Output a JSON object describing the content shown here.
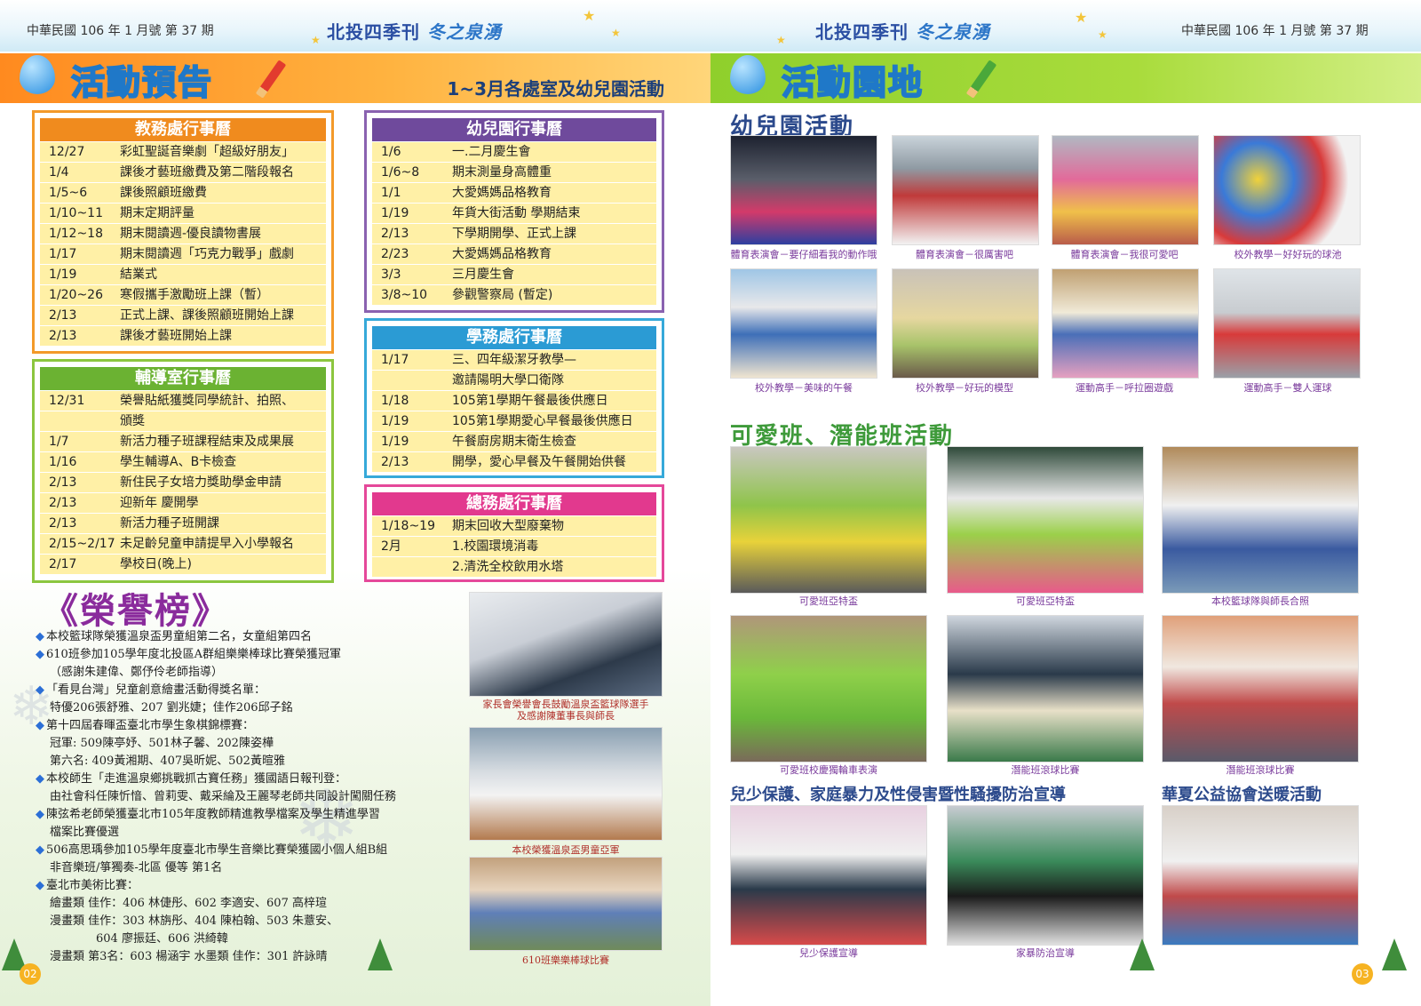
{
  "left": {
    "issue": "中華民國 106 年 1 月號 第 37 期",
    "mag_title": "北投四季刊",
    "mag_sub": "冬之泉湧",
    "banner_title": "活動預告",
    "banner_sub": "1~3月各處室及幼兒園活動",
    "page_num": "02",
    "calendars": [
      {
        "title": "教務處行事曆",
        "rows": [
          {
            "d": "12/27",
            "t": "彩虹聖誕音樂劇「超級好朋友」"
          },
          {
            "d": "1/4",
            "t": "課後才藝班繳費及第二階段報名"
          },
          {
            "d": "1/5~6",
            "t": "課後照顧班繳費"
          },
          {
            "d": "1/10~11",
            "t": "期末定期評量"
          },
          {
            "d": "1/12~18",
            "t": "期末閱讀週-優良讀物書展"
          },
          {
            "d": "1/17",
            "t": "期末閱讀週「巧克力戰爭」戲劇"
          },
          {
            "d": "1/19",
            "t": "結業式"
          },
          {
            "d": "1/20~26",
            "t": "寒假攜手激勵班上課（暫）"
          },
          {
            "d": "2/13",
            "t": "正式上課、課後照顧班開始上課"
          },
          {
            "d": "2/13",
            "t": "課後才藝班開始上課"
          }
        ]
      },
      {
        "title": "輔導室行事曆",
        "rows": [
          {
            "d": "12/31",
            "t": "榮譽貼紙獲獎同學統計、拍照、"
          },
          {
            "d": "",
            "t": "頒獎"
          },
          {
            "d": "1/7",
            "t": "新活力種子班課程結束及成果展"
          },
          {
            "d": "1/16",
            "t": "學生輔導A、B卡檢查"
          },
          {
            "d": "2/13",
            "t": "新住民子女培力獎助學金申請"
          },
          {
            "d": "2/13",
            "t": "迎新年 慶開學"
          },
          {
            "d": "2/13",
            "t": "新活力種子班開課"
          },
          {
            "d": "2/15~2/17",
            "t": "未足齡兒童申請提早入小學報名"
          },
          {
            "d": "2/17",
            "t": "學校日(晚上)"
          }
        ]
      },
      {
        "title": "幼兒園行事曆",
        "rows": [
          {
            "d": "1/6",
            "t": "一.二月慶生會"
          },
          {
            "d": "1/6~8",
            "t": "期末測量身高體重"
          },
          {
            "d": "1/1",
            "t": "大愛媽媽品格教育"
          },
          {
            "d": "1/19",
            "t": "年貨大街活動 學期結束"
          },
          {
            "d": "2/13",
            "t": "下學期開學、正式上課"
          },
          {
            "d": "2/23",
            "t": "大愛媽媽品格教育"
          },
          {
            "d": "3/3",
            "t": "三月慶生會"
          },
          {
            "d": "3/8~10",
            "t": "參觀警察局 (暫定)"
          }
        ]
      },
      {
        "title": "學務處行事曆",
        "rows": [
          {
            "d": "1/17",
            "t": "三、四年級潔牙教學—"
          },
          {
            "d": "",
            "t": "邀請陽明大學口衛隊"
          },
          {
            "d": "1/18",
            "t": "105第1學期午餐最後供應日"
          },
          {
            "d": "1/19",
            "t": "105第1學期愛心早餐最後供應日"
          },
          {
            "d": "1/19",
            "t": "午餐廚房期末衛生檢查"
          },
          {
            "d": "2/13",
            "t": "開學，愛心早餐及午餐開始供餐"
          }
        ]
      },
      {
        "title": "總務處行事曆",
        "rows": [
          {
            "d": "1/18~19",
            "t": "期末回收大型廢棄物"
          },
          {
            "d": "2月",
            "t": "1.校園環境消毒"
          },
          {
            "d": "",
            "t": "2.清洗全校飲用水塔"
          }
        ]
      }
    ],
    "honor_title": "《榮譽榜》",
    "honor_items": [
      [
        "本校籃球隊榮獲溫泉盃男童組第二名，女童組第四名"
      ],
      [
        "610班參加105學年度北投區A群組樂樂棒球比賽榮獲冠軍",
        "（感謝朱建偉、鄭伃伶老師指導）"
      ],
      [
        "「看見台灣」兒童創意繪畫活動得獎名單：",
        "特優206張舒雅、207 劉兆婕；佳作206邱子銘"
      ],
      [
        "第十四屆春暉盃臺北市學生象棋錦標賽：",
        "冠軍: 509陳亭妤、501林子馨、202陳姿樺",
        "第六名: 409黃湘期、407吳昕妮、502黃暄雅"
      ],
      [
        "本校師生「走進溫泉鄉挑戰抓古寶任務」獲國語日報刊登：",
        "由社會科任陳忻愔、曾莉雯、戴采綸及王麗琴老師共同設計闖關任務"
      ],
      [
        "陳弦希老師榮獲臺北市105年度教師精進教學檔案及學生精進學習",
        "檔案比賽優選"
      ],
      [
        "506高思瑀參加105學年度臺北市學生音樂比賽榮獲國小個人組B組",
        "非音樂班/箏獨奏-北區 優等 第1名"
      ],
      [
        "臺北市美術比賽：",
        "繪畫類 佳作：406 林倢彤、602 李適安、607 高梓瑄",
        "漫畫類 佳作：303 林旃彤、404 陳柏翰、503 朱薏安、",
        "　　　　604 廖振廷、606 洪綺韓",
        "漫畫類 第3名：603 楊涵宇  水墨類 佳作：301 許詠晴"
      ]
    ],
    "photo_captions": [
      "家長會榮譽會長鼓勵溫泉盃籃球隊選手",
      "及感謝陳董事長與師長",
      "本校榮獲溫泉盃男童亞軍",
      "610班樂樂棒球比賽"
    ]
  },
  "right": {
    "issue": "中華民國 106 年 1 月號 第 37 期",
    "mag_title": "北投四季刊",
    "mag_sub": "冬之泉湧",
    "banner_title": "活動園地",
    "page_num": "03",
    "sec1_title": "幼兒園活動",
    "sec1_captions": [
      "體育表演會－要仔細看我的動作哦",
      "體育表演會－很厲害吧",
      "體育表演會－我很可愛吧",
      "校外教學－好好玩的球池",
      "校外教學－美味的午餐",
      "校外教學－好玩的模型",
      "運動高手－呼拉圈遊戲",
      "運動高手－雙人運球"
    ],
    "sec2_title": "可愛班、潛能班活動",
    "sec2_captions": [
      "可愛班亞特盃",
      "可愛班亞特盃",
      "本校籃球隊與師長合照",
      "可愛班校慶獨輪車表演",
      "潛能班滾球比賽",
      "潛能班滾球比賽"
    ],
    "sec3_title": "兒少保護、家庭暴力及性侵害暨性騷擾防治宣導",
    "sec4_title": "華夏公益協會送暖活動",
    "sec3_captions": [
      "兒少保護宣導",
      "家暴防治宣導"
    ]
  },
  "colors": {
    "orange_banner": "#ff8a1f",
    "green_banner": "#9bd33a",
    "edu_box": "#f39a2a",
    "counsel_box": "#8cc63f",
    "kinder_box": "#8a62b0",
    "student_box": "#36a9d9",
    "general_box": "#e5489a"
  }
}
